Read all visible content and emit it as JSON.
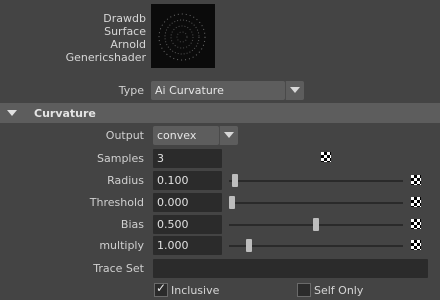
{
  "swatch": {
    "lines": [
      "Drawdb",
      "Surface",
      "Arnold",
      "Genericshader"
    ]
  },
  "type": {
    "label": "Type",
    "value": "Ai Curvature"
  },
  "section": {
    "title": "Curvature"
  },
  "output": {
    "label": "Output",
    "value": "convex"
  },
  "samples": {
    "label": "Samples",
    "value": "3"
  },
  "sliders": [
    {
      "label": "Radius",
      "value": "0.100",
      "level": 0.02
    },
    {
      "label": "Threshold",
      "value": "0.000",
      "level": 0.0
    },
    {
      "label": "Bias",
      "value": "0.500",
      "level": 0.5
    },
    {
      "label": "multiply",
      "value": "1.000",
      "level": 0.1
    }
  ],
  "trace_set": {
    "label": "Trace Set",
    "value": ""
  },
  "inclusive": {
    "label": "Inclusive",
    "checked": true
  },
  "self_only": {
    "label": "Self Only",
    "checked": false
  },
  "colors": {
    "background": "#444444",
    "field": "#2b2b2b",
    "section": "#5d5d5d"
  }
}
